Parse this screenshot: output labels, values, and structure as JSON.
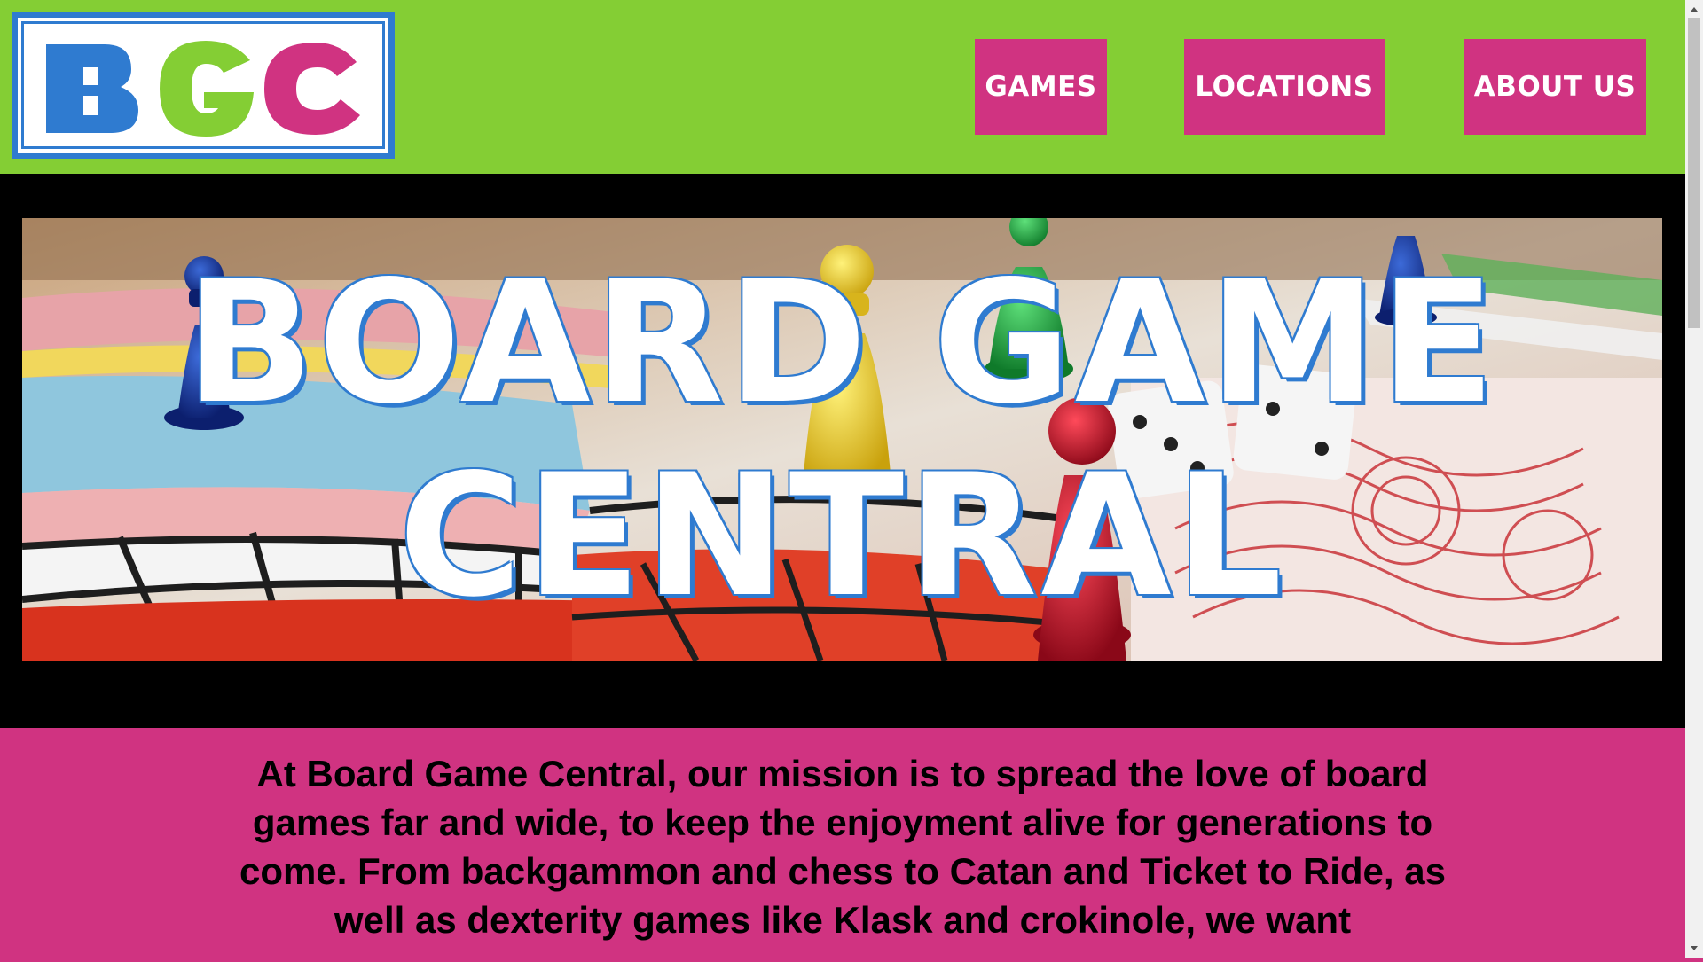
{
  "header": {
    "logo_letters": [
      "B",
      "G",
      "C"
    ],
    "logo_letter_colors": [
      "#2f7bd0",
      "#84ce34",
      "#d03381"
    ],
    "nav": [
      {
        "label": "GAMES"
      },
      {
        "label": "LOCATIONS"
      },
      {
        "label": "ABOUT US"
      }
    ]
  },
  "hero": {
    "title_line1": "BOARD GAME",
    "title_line2": "CENTRAL",
    "image": "board-game-pieces-photo"
  },
  "mission": {
    "text": "At Board Game Central, our mission is to spread the love of board games far and wide, to keep the enjoyment alive for generations to come. From backgammon and chess to Catan and Ticket to Ride, as well as dexterity games like Klask and crokinole, we want"
  },
  "colors": {
    "header_bg": "#84ce34",
    "accent_pink": "#d03381",
    "accent_blue": "#2f7bd0",
    "hero_bg": "#000000"
  },
  "scrollbar": {
    "position_fraction": 0.0
  }
}
